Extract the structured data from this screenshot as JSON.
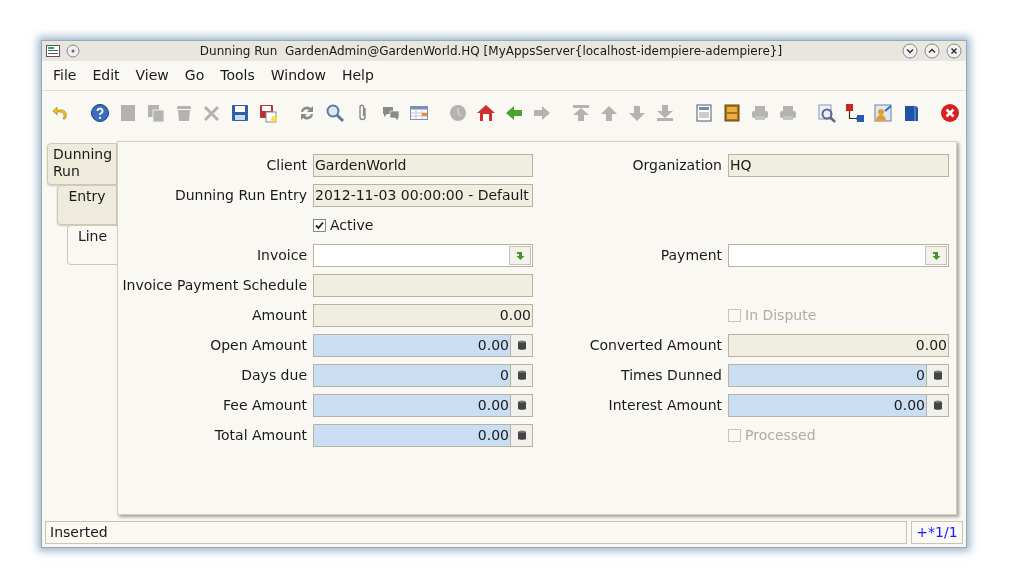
{
  "window": {
    "title": "Dunning Run  GardenAdmin@GardenWorld.HQ [MyAppsServer{localhost-idempiere-adempiere}]"
  },
  "menu": [
    {
      "label": "File"
    },
    {
      "label": "Edit"
    },
    {
      "label": "View"
    },
    {
      "label": "Go"
    },
    {
      "label": "Tools"
    },
    {
      "label": "Window"
    },
    {
      "label": "Help"
    }
  ],
  "toolbar": [
    [
      {
        "kind": "undo",
        "disabled": false
      }
    ],
    [
      {
        "kind": "help",
        "disabled": false
      },
      {
        "kind": "new",
        "disabled": true
      },
      {
        "kind": "copy",
        "disabled": true
      },
      {
        "kind": "delete",
        "disabled": true
      },
      {
        "kind": "delete_selection",
        "disabled": true
      },
      {
        "kind": "save",
        "disabled": false
      },
      {
        "kind": "save_new",
        "disabled": false
      }
    ],
    [
      {
        "kind": "refresh",
        "disabled": false
      },
      {
        "kind": "find",
        "disabled": false
      },
      {
        "kind": "attachment",
        "disabled": false
      },
      {
        "kind": "chat",
        "disabled": false
      },
      {
        "kind": "grid",
        "disabled": false
      }
    ],
    [
      {
        "kind": "history",
        "disabled": true
      },
      {
        "kind": "home",
        "disabled": false
      },
      {
        "kind": "back",
        "disabled": false
      },
      {
        "kind": "forward",
        "disabled": true
      }
    ],
    [
      {
        "kind": "first",
        "disabled": true
      },
      {
        "kind": "previous",
        "disabled": true
      },
      {
        "kind": "next",
        "disabled": true
      },
      {
        "kind": "last",
        "disabled": true
      }
    ],
    [
      {
        "kind": "report",
        "disabled": false
      },
      {
        "kind": "archive",
        "disabled": false
      },
      {
        "kind": "print",
        "disabled": true
      },
      {
        "kind": "print_preview",
        "disabled": true
      }
    ],
    [
      {
        "kind": "zoom_across",
        "disabled": false
      },
      {
        "kind": "workflow",
        "disabled": false
      },
      {
        "kind": "request",
        "disabled": false
      },
      {
        "kind": "product_info",
        "disabled": false
      }
    ],
    [
      {
        "kind": "close",
        "disabled": false
      }
    ]
  ],
  "tabs": [
    {
      "label": "Dunning Run",
      "selected": false
    },
    {
      "label": "Entry",
      "selected": false
    },
    {
      "label": "Line",
      "selected": true
    }
  ],
  "form": {
    "rows": [
      {
        "left": {
          "kind": "display",
          "label": "Client",
          "value": "GardenWorld"
        },
        "right": {
          "kind": "display",
          "label": "Organization",
          "value": "HQ"
        }
      },
      {
        "left": {
          "kind": "display",
          "label": "Dunning Run Entry",
          "value": "2012-11-03 00:00:00 - Default"
        }
      },
      {
        "left": {
          "kind": "checkbox",
          "label": "Active",
          "checked": true,
          "disabled": false
        }
      },
      {
        "left": {
          "kind": "lookup",
          "label": "Invoice"
        },
        "right": {
          "kind": "lookup",
          "label": "Payment"
        }
      },
      {
        "left": {
          "kind": "display",
          "label": "Invoice Payment Schedule"
        }
      },
      {
        "left": {
          "kind": "display_number",
          "label": "Amount",
          "value": "0.00"
        },
        "right": {
          "kind": "checkbox",
          "label": "In Dispute",
          "checked": false,
          "disabled": true
        }
      },
      {
        "left": {
          "kind": "number",
          "label": "Open Amount",
          "value": "0.00"
        },
        "right": {
          "kind": "display_number",
          "label": "Converted Amount",
          "value": "0.00"
        }
      },
      {
        "left": {
          "kind": "number",
          "label": "Days due",
          "value": "0"
        },
        "right": {
          "kind": "number",
          "label": "Times Dunned",
          "value": "0"
        }
      },
      {
        "left": {
          "kind": "number",
          "label": "Fee Amount",
          "value": "0.00"
        },
        "right": {
          "kind": "number",
          "label": "Interest Amount",
          "value": "0.00"
        }
      },
      {
        "left": {
          "kind": "number",
          "label": "Total Amount",
          "value": "0.00"
        },
        "right": {
          "kind": "checkbox",
          "label": "Processed",
          "checked": false,
          "disabled": true
        }
      }
    ]
  },
  "status_bar": {
    "message": "Inserted",
    "record": "+*1/1"
  }
}
